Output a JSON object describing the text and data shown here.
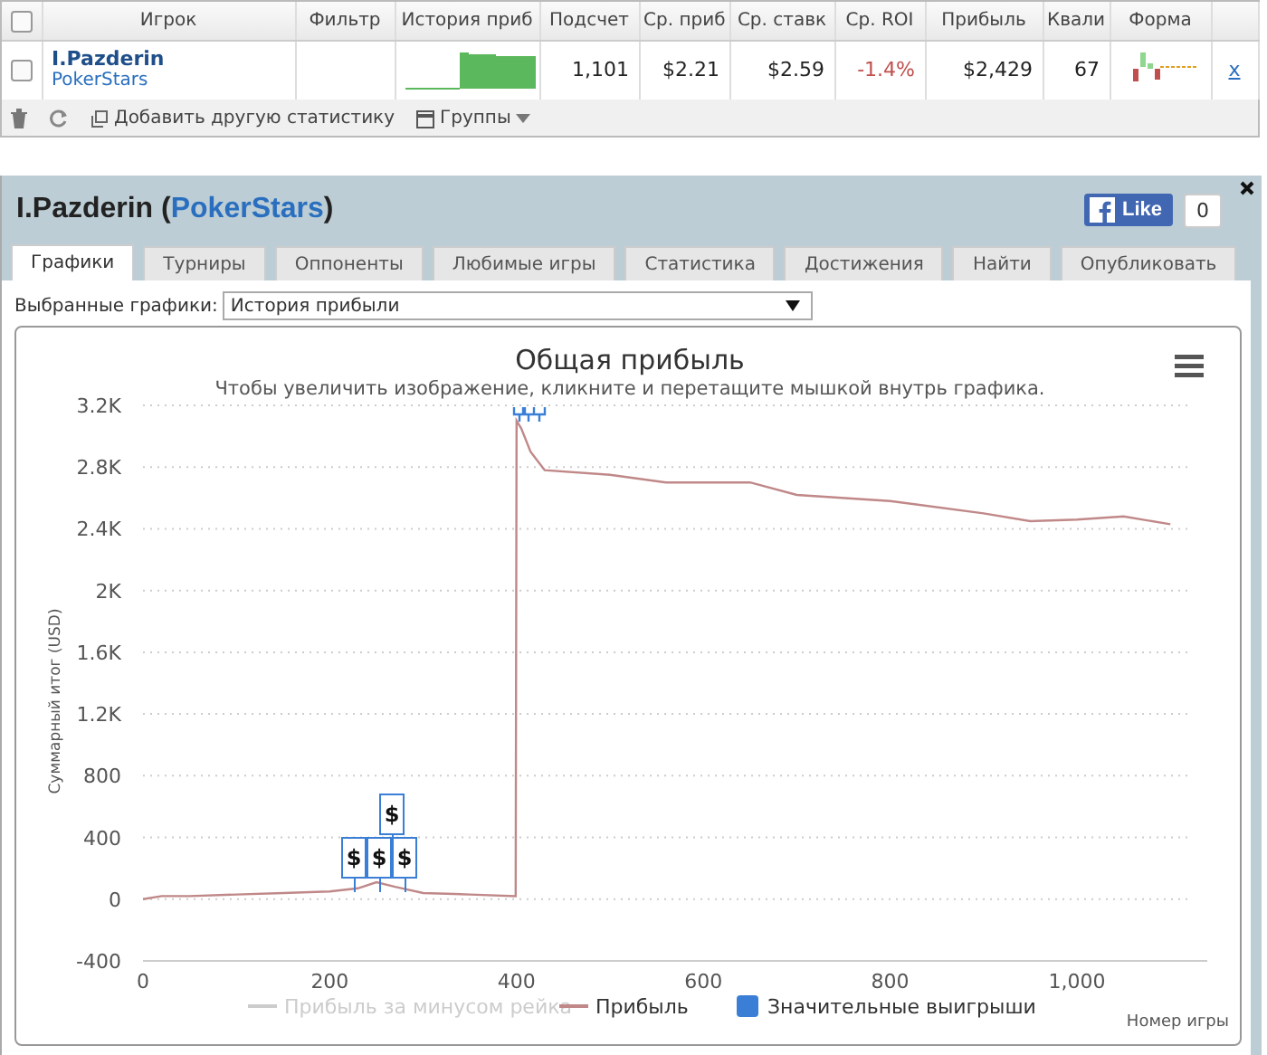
{
  "stats_table": {
    "header_checked": false,
    "columns": [
      "Игрок",
      "Фильтр",
      "История приб",
      "Подсчет",
      "Ср. приб",
      "Ср. ставк",
      "Ср. ROI",
      "Прибыль",
      "Квали",
      "Форма"
    ],
    "rows": [
      {
        "checked": false,
        "player": "I.Pazderin",
        "site": "PokerStars",
        "values": [
          {
            "text": "1,101",
            "negative": false
          },
          {
            "text": "$2.21",
            "negative": false
          },
          {
            "text": "$2.59",
            "negative": false
          },
          {
            "text": "-1.4%",
            "negative": true
          },
          {
            "text": "$2,429",
            "negative": false
          },
          {
            "text": "67",
            "negative": false
          }
        ],
        "remove": "x"
      }
    ]
  },
  "toolbar": [
    {
      "kind": "delete"
    },
    {
      "kind": "refresh"
    },
    {
      "kind": "add",
      "label": "Добавить другую статистику"
    },
    {
      "kind": "groups",
      "label": "Группы"
    }
  ],
  "panel": {
    "title_prefix": "I.Pazderin (",
    "site": "PokerStars",
    "title_suffix": ")",
    "like": {
      "label": "Like",
      "count": "0"
    },
    "tabs": [
      {
        "label": "Графики",
        "selected": true
      },
      {
        "label": "Турниры",
        "selected": false
      },
      {
        "label": "Оппоненты",
        "selected": false
      },
      {
        "label": "Любимые игры",
        "selected": false
      },
      {
        "label": "Статистика",
        "selected": false
      },
      {
        "label": "Достижения",
        "selected": false
      },
      {
        "label": "Найти",
        "selected": false
      },
      {
        "label": "Опубликовать",
        "selected": false
      }
    ],
    "chart_select": {
      "label": "Выбранные графики:",
      "value": "История прибыли"
    },
    "chart": {
      "hint": "Чтобы увеличить изображение, кликните и перетащите мышкой внутрь графика.",
      "chart_data": {
        "type": "line",
        "title": "Общая прибыль",
        "xlabel": "Номер игры",
        "ylabel": "Суммарный итог (USD)",
        "x": [
          0,
          20,
          50,
          100,
          150,
          200,
          230,
          250,
          270,
          300,
          350,
          399,
          400,
          405,
          415,
          430,
          500,
          560,
          650,
          700,
          800,
          900,
          950,
          1000,
          1050,
          1100
        ],
        "series": [
          {
            "name": "Прибыль",
            "color": "#c08888",
            "values": [
              0,
              20,
              20,
              30,
              40,
              50,
              70,
              110,
              80,
              40,
              30,
              20,
              3100,
              3050,
              2900,
              2780,
              2750,
              2700,
              2700,
              2620,
              2580,
              2500,
              2450,
              2460,
              2480,
              2430
            ]
          }
        ],
        "xlim": [
          0,
          1124
        ],
        "ylim": [
          -400,
          3200
        ],
        "xticks": [
          0,
          200,
          400,
          600,
          800,
          {
            "value": 1000,
            "label": "1,000"
          }
        ],
        "yticks": [
          {
            "value": -400,
            "label": "-400"
          },
          0,
          400,
          800,
          {
            "value": 1200,
            "label": "1.2K"
          },
          {
            "value": 1600,
            "label": "1.6K"
          },
          {
            "value": 2000,
            "label": "2K"
          },
          {
            "value": 2400,
            "label": "2.4K"
          },
          {
            "value": 2800,
            "label": "2.8K"
          },
          {
            "value": 3200,
            "label": "3.2K"
          }
        ],
        "grid": true
      },
      "flags": [
        {
          "text": "$"
        },
        {
          "text": "$"
        },
        {
          "text": "$"
        },
        {
          "text": "$"
        }
      ],
      "legend": [
        {
          "kind": "line",
          "label": "Прибыль за минусом рейка",
          "enabled": false,
          "color": "#cccccc"
        },
        {
          "kind": "series",
          "enabled": true
        },
        {
          "kind": "flag",
          "label": "Значительные выигрыши",
          "enabled": true,
          "color": "#3a7fd5"
        }
      ]
    }
  }
}
